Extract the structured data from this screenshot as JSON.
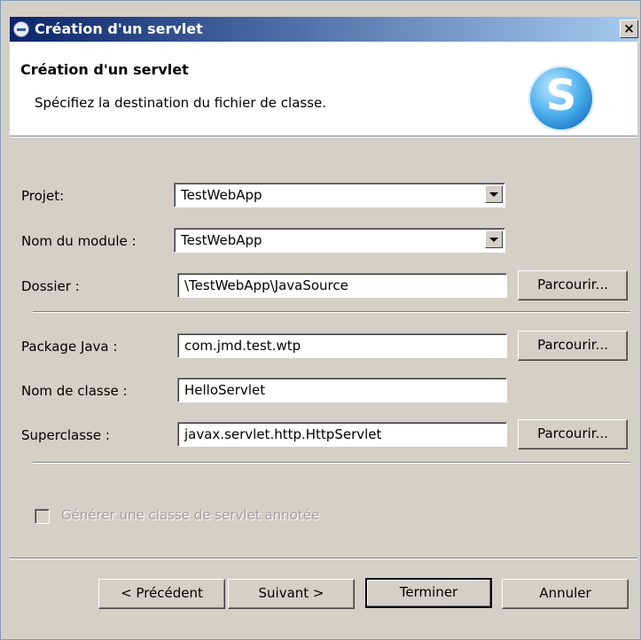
{
  "window": {
    "title": "Création d'un servlet",
    "close_label": "×"
  },
  "header": {
    "title": "Création d'un servlet",
    "description": "Spécifiez la destination du fichier de classe.",
    "logo_letter": "S"
  },
  "form": {
    "project_label": "Projet:",
    "project_value": "TestWebApp",
    "module_label": "Nom du module :",
    "module_value": "TestWebApp",
    "folder_label": "Dossier :",
    "folder_value": "\\TestWebApp\\JavaSource",
    "package_label": "Package Java :",
    "package_value": "com.jmd.test.wtp",
    "class_label": "Nom de classe :",
    "class_value": "HelloServlet",
    "superclass_label": "Superclasse :",
    "superclass_value": "javax.servlet.http.HttpServlet",
    "browse_label": "Parcourir...",
    "annotated_label": "Générer une classe de servlet annotée",
    "annotated_checked": false
  },
  "buttons": {
    "previous": "< Précédent",
    "next": "Suivant >",
    "finish": "Terminer",
    "cancel": "Annuler"
  },
  "colors": {
    "titlebar_start": "#0a246a",
    "titlebar_end": "#a6caf0",
    "dialog_bg": "#d4d0c8",
    "disabled_text": "#a0a0a0"
  }
}
